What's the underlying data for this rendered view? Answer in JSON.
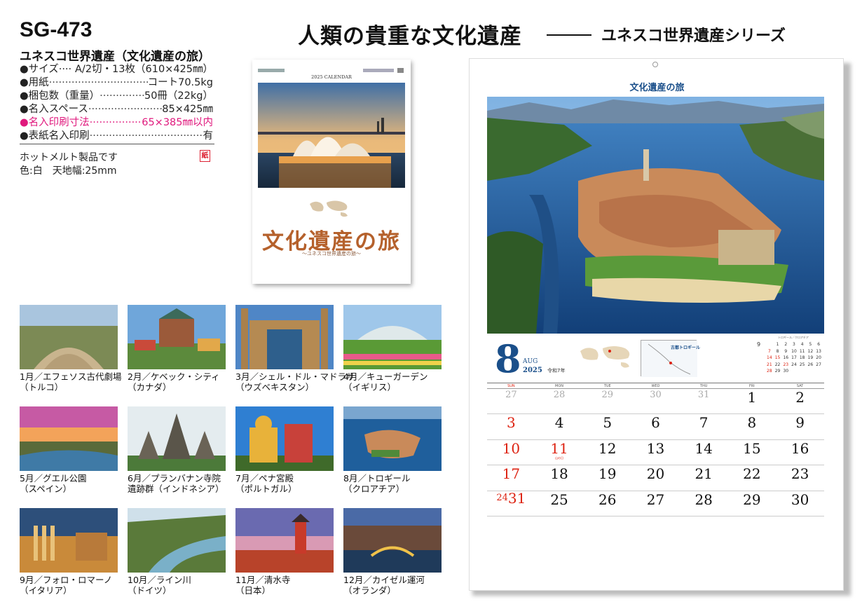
{
  "header": {
    "main_title": "人類の貴重な文化遺産",
    "series": "ユネスコ世界遺産シリーズ"
  },
  "product": {
    "code": "SG-473",
    "name": "ユネスコ世界遺産（文化遺産の旅）",
    "specs": [
      {
        "label": "●サイズ····",
        "value": "A/2切・13枚（610×425㎜）",
        "dots": false
      },
      {
        "label": "●用紙",
        "value": "コート70.5kg",
        "dots": true
      },
      {
        "label": "●梱包数（重量）",
        "value": "50冊（22kg）",
        "dots": true
      },
      {
        "label": "●名入スペース",
        "value": "85×425㎜",
        "dots": true
      },
      {
        "label": "●名入印刷寸法",
        "value": "65×385㎜以内",
        "dots": true,
        "highlight": true
      },
      {
        "label": "●表紙名入印刷",
        "value": "有",
        "dots": true
      }
    ],
    "note1": "ホットメルト製品です",
    "note2": "色:白　天地幅:25mm",
    "paper_badge": "紙"
  },
  "cover": {
    "year_label": "2025 CALENDAR",
    "title": "文化遺産の旅",
    "subtitle": "〜ユネスコ世界遺産の旅〜"
  },
  "months": [
    {
      "line1": "1月／エフェソス古代劇場",
      "line2": "（トルコ）"
    },
    {
      "line1": "2月／ケベック・シティ",
      "line2": "（カナダ）"
    },
    {
      "line1": "3月／シェル・ドル・マドラサ",
      "line2": "（ウズベキスタン）"
    },
    {
      "line1": "4月／キューガーデン",
      "line2": "（イギリス）"
    },
    {
      "line1": "5月／グエル公園",
      "line2": "（スペイン）"
    },
    {
      "line1": "6月／プランバナン寺院",
      "line2": "遺跡群（インドネシア）"
    },
    {
      "line1": "7月／ペナ宮殿",
      "line2": "（ポルトガル）"
    },
    {
      "line1": "8月／トロギール",
      "line2": "（クロアチア）"
    },
    {
      "line1": "9月／フォロ・ロマーノ",
      "line2": "（イタリア）"
    },
    {
      "line1": "10月／ライン川",
      "line2": "（ドイツ）"
    },
    {
      "line1": "11月／清水寺",
      "line2": "（日本）"
    },
    {
      "line1": "12月／カイゼル運河",
      "line2": "（オランダ）"
    }
  ],
  "calendar": {
    "title": "文化遺産の旅",
    "month_number": "8",
    "month_en": "AUG",
    "year": "2025",
    "reiwa": "令和7年",
    "info_title": "古都トロギール",
    "photo_credit": "トロギール／クロアチア",
    "mini_month": "9",
    "mini_days": [
      [
        "",
        "1",
        "2",
        "3",
        "4",
        "5",
        "6"
      ],
      [
        "7",
        "8",
        "9",
        "10",
        "11",
        "12",
        "13"
      ],
      [
        "14",
        "15",
        "16",
        "17",
        "18",
        "19",
        "20"
      ],
      [
        "21",
        "22",
        "23",
        "24",
        "25",
        "26",
        "27"
      ],
      [
        "28",
        "29",
        "30",
        "",
        "",
        "",
        ""
      ]
    ],
    "weekdays": [
      "SUN",
      "MON",
      "TUE",
      "WED",
      "THU",
      "FRI",
      "SAT"
    ],
    "weeks": [
      [
        "27",
        "28",
        "29",
        "30",
        "31",
        "1",
        "2"
      ],
      [
        "3",
        "4",
        "5",
        "6",
        "7",
        "8",
        "9"
      ],
      [
        "10",
        "11",
        "12",
        "13",
        "14",
        "15",
        "16"
      ],
      [
        "17",
        "18",
        "19",
        "20",
        "21",
        "22",
        "23"
      ],
      [
        "24",
        "25",
        "26",
        "27",
        "28",
        "29",
        "30"
      ]
    ],
    "combined_day": "31",
    "holiday_note": "山の日"
  },
  "colors": {
    "accent_blue": "#1a4f8a",
    "holiday_red": "#d21",
    "magenta": "#e0197d",
    "cover_title": "#b5612c"
  }
}
